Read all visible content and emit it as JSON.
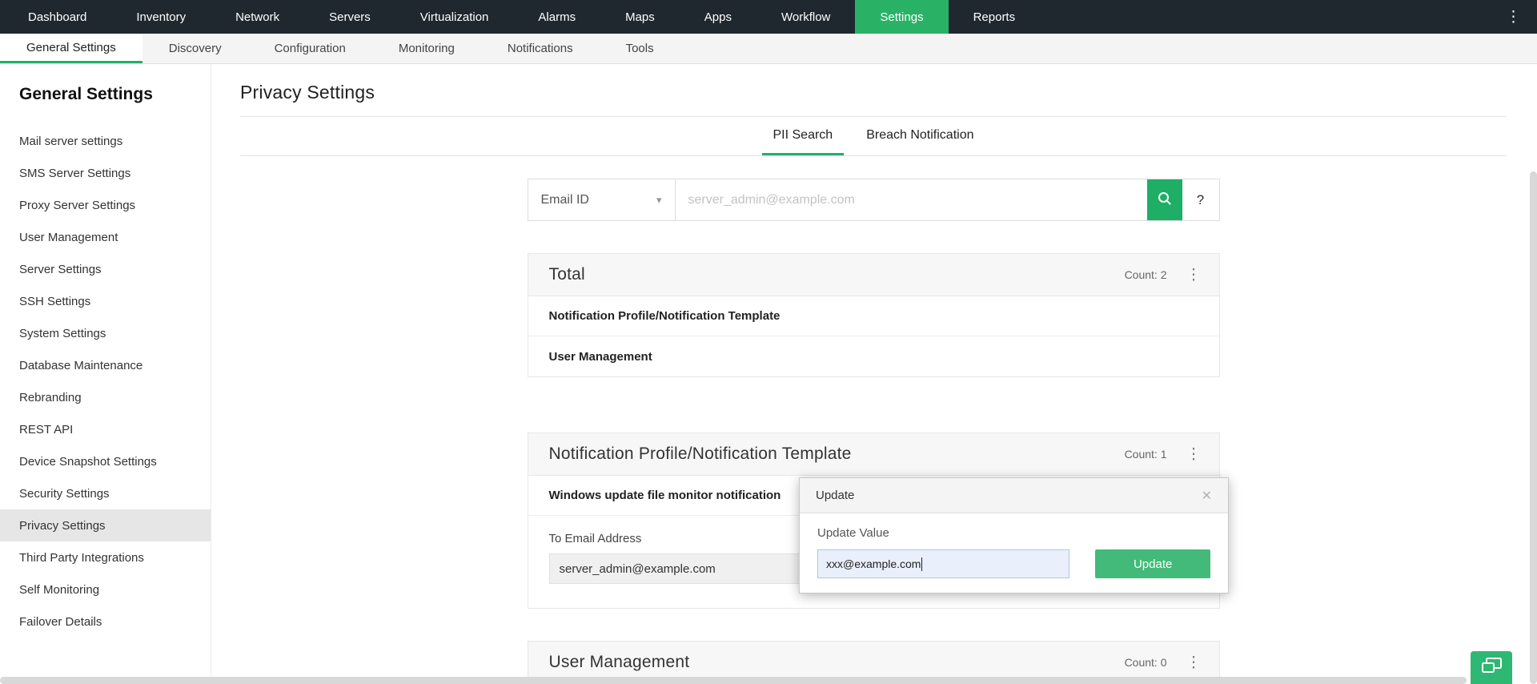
{
  "top_nav": {
    "items": [
      "Dashboard",
      "Inventory",
      "Network",
      "Servers",
      "Virtualization",
      "Alarms",
      "Maps",
      "Apps",
      "Workflow",
      "Settings",
      "Reports"
    ],
    "active": "Settings"
  },
  "sub_nav": {
    "items": [
      "General Settings",
      "Discovery",
      "Configuration",
      "Monitoring",
      "Notifications",
      "Tools"
    ],
    "active": "General Settings"
  },
  "sidebar": {
    "title": "General Settings",
    "items": [
      "Mail server settings",
      "SMS Server Settings",
      "Proxy Server Settings",
      "User Management",
      "Server Settings",
      "SSH Settings",
      "System Settings",
      "Database Maintenance",
      "Rebranding",
      "REST API",
      "Device Snapshot Settings",
      "Security Settings",
      "Privacy Settings",
      "Third Party Integrations",
      "Self Monitoring",
      "Failover Details"
    ],
    "active": "Privacy Settings"
  },
  "main": {
    "title": "Privacy Settings",
    "tabs": [
      {
        "label": "PII Search",
        "active": true
      },
      {
        "label": "Breach Notification",
        "active": false
      }
    ],
    "search": {
      "category": "Email ID",
      "placeholder": "server_admin@example.com",
      "help": "?"
    },
    "cards": [
      {
        "title": "Total",
        "count_label": "Count: 2",
        "rows": [
          "Notification Profile/Notification Template",
          "User Management"
        ]
      },
      {
        "title": "Notification Profile/Notification Template",
        "count_label": "Count: 1",
        "rows": [
          "Windows update file monitor notification"
        ],
        "detail": {
          "field_label": "To Email Address",
          "field_value": "server_admin@example.com"
        }
      },
      {
        "title": "User Management",
        "count_label": "Count: 0",
        "rows": []
      }
    ],
    "popup": {
      "title": "Update",
      "field_label": "Update Value",
      "field_value": "xxx@example.com",
      "button_label": "Update"
    }
  },
  "icons": {
    "kebab": "⋮",
    "overflow": "⋮",
    "caret_down": "▾",
    "close": "✕"
  },
  "colors": {
    "nav_bg": "#1f282e",
    "accent_green": "#21b06a",
    "settings_tab_green": "#29b266",
    "search_button_green": "#1fae66",
    "update_button_green": "#43ba79",
    "fab_green": "#2eb873"
  }
}
